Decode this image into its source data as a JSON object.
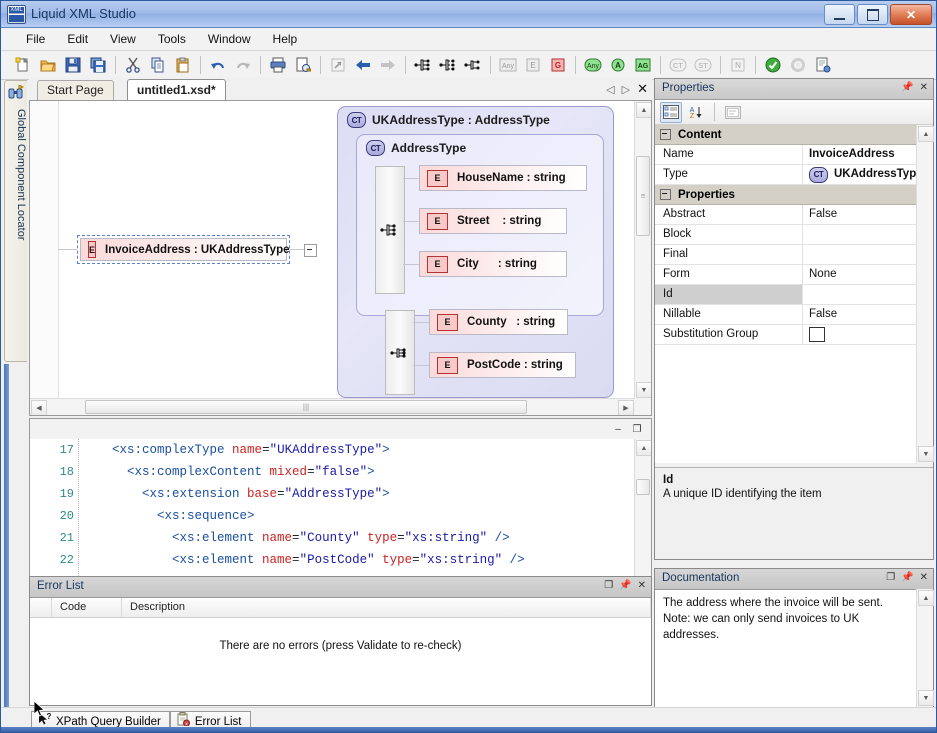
{
  "window": {
    "title": "Liquid XML Studio",
    "icon": "xml-app-icon",
    "buttons": {
      "minimize": "–",
      "maximize": "□",
      "close": "✕"
    }
  },
  "menu": {
    "items": [
      "File",
      "Edit",
      "View",
      "Tools",
      "Window",
      "Help"
    ]
  },
  "toolbar": {
    "groups": [
      {
        "buttons": [
          {
            "name": "new-file-icon",
            "glyph": "🗋"
          },
          {
            "name": "open-file-icon",
            "glyph": "📂"
          },
          {
            "name": "save-icon",
            "glyph": "💾"
          },
          {
            "name": "save-all-icon",
            "glyph": "🖫"
          }
        ]
      },
      {
        "buttons": [
          {
            "name": "cut-icon",
            "glyph": "✂"
          },
          {
            "name": "copy-icon",
            "glyph": "⧉"
          },
          {
            "name": "paste-icon",
            "glyph": "📋"
          }
        ]
      },
      {
        "buttons": [
          {
            "name": "undo-icon",
            "glyph": "↶"
          },
          {
            "name": "redo-icon",
            "glyph": "↷"
          }
        ]
      },
      {
        "buttons": [
          {
            "name": "print-icon",
            "glyph": "🖨"
          },
          {
            "name": "print-preview-icon",
            "glyph": "🔍"
          }
        ]
      },
      {
        "buttons": [
          {
            "name": "navigate-icon",
            "glyph": "↗"
          },
          {
            "name": "back-icon",
            "glyph": "⬅"
          },
          {
            "name": "forward-icon",
            "glyph": "➡"
          }
        ]
      },
      {
        "buttons": [
          {
            "name": "add-sequence-icon",
            "glyph": "seq"
          },
          {
            "name": "add-choice-icon",
            "glyph": "seq"
          },
          {
            "name": "add-all-icon",
            "glyph": "seq"
          }
        ]
      },
      {
        "buttons": [
          {
            "name": "any-icon",
            "glyph": "Any"
          },
          {
            "name": "element-icon",
            "glyph": "E"
          },
          {
            "name": "group-icon",
            "glyph": "G"
          }
        ]
      },
      {
        "buttons": [
          {
            "name": "any-attribute-icon",
            "glyph": "Any"
          },
          {
            "name": "attribute-icon",
            "glyph": "A"
          },
          {
            "name": "attribute-group-icon",
            "glyph": "AG"
          }
        ]
      },
      {
        "buttons": [
          {
            "name": "complex-type-icon",
            "glyph": "CT"
          },
          {
            "name": "simple-type-icon",
            "glyph": "ST"
          }
        ]
      },
      {
        "buttons": [
          {
            "name": "notation-icon",
            "glyph": "N"
          }
        ]
      },
      {
        "buttons": [
          {
            "name": "validate-icon",
            "glyph": "✔"
          },
          {
            "name": "settings-icon",
            "glyph": "⚙"
          },
          {
            "name": "generate-code-icon",
            "glyph": "📄"
          }
        ]
      }
    ]
  },
  "left_sidebar": {
    "tab_label": "Global Component Locator",
    "icon": "binoculars-icon"
  },
  "document_tabs": {
    "tabs": [
      {
        "label": "Start Page",
        "active": false
      },
      {
        "label": "untitled1.xsd*",
        "active": true
      }
    ],
    "nav": {
      "prev": "◁",
      "next": "▷",
      "close": "✕"
    }
  },
  "diagram": {
    "selected_node": {
      "badge": "E",
      "label": "InvoiceAddress : UKAddressType"
    },
    "outer_type": {
      "badge": "CT",
      "label": "UKAddressType : AddressType"
    },
    "inner_type": {
      "badge": "CT",
      "label": "AddressType"
    },
    "inner_elements": [
      {
        "badge": "E",
        "label": "HouseName : string"
      },
      {
        "badge": "E",
        "label": "Street    : string"
      },
      {
        "badge": "E",
        "label": "City      : string"
      }
    ],
    "outer_elements": [
      {
        "badge": "E",
        "label": "County   : string"
      },
      {
        "badge": "E",
        "label": "PostCode : string"
      }
    ]
  },
  "code_editor": {
    "header_buttons": {
      "minimize": "–",
      "maximize": "❐"
    },
    "lines": [
      {
        "number": "17",
        "indent": 2,
        "tokens": [
          {
            "t": "tg",
            "v": "<xs:complexType "
          },
          {
            "t": "at",
            "v": "name"
          },
          {
            "t": "pl",
            "v": "="
          },
          {
            "t": "vl",
            "v": "\"UKAddressType\""
          },
          {
            "t": "tg",
            "v": ">"
          }
        ]
      },
      {
        "number": "18",
        "indent": 3,
        "tokens": [
          {
            "t": "tg",
            "v": "<xs:complexContent "
          },
          {
            "t": "at",
            "v": "mixed"
          },
          {
            "t": "pl",
            "v": "="
          },
          {
            "t": "vl",
            "v": "\"false\""
          },
          {
            "t": "tg",
            "v": ">"
          }
        ]
      },
      {
        "number": "19",
        "indent": 4,
        "tokens": [
          {
            "t": "tg",
            "v": "<xs:extension "
          },
          {
            "t": "at",
            "v": "base"
          },
          {
            "t": "pl",
            "v": "="
          },
          {
            "t": "vl",
            "v": "\"AddressType\""
          },
          {
            "t": "tg",
            "v": ">"
          }
        ]
      },
      {
        "number": "20",
        "indent": 5,
        "tokens": [
          {
            "t": "tg",
            "v": "<xs:sequence>"
          }
        ]
      },
      {
        "number": "21",
        "indent": 6,
        "tokens": [
          {
            "t": "tg",
            "v": "<xs:element "
          },
          {
            "t": "at",
            "v": "name"
          },
          {
            "t": "pl",
            "v": "="
          },
          {
            "t": "vl",
            "v": "\"County\""
          },
          {
            "t": "pl",
            "v": " "
          },
          {
            "t": "at",
            "v": "type"
          },
          {
            "t": "pl",
            "v": "="
          },
          {
            "t": "vl",
            "v": "\"xs:string\""
          },
          {
            "t": "tg",
            "v": " />"
          }
        ]
      },
      {
        "number": "22",
        "indent": 6,
        "tokens": [
          {
            "t": "tg",
            "v": "<xs:element "
          },
          {
            "t": "at",
            "v": "name"
          },
          {
            "t": "pl",
            "v": "="
          },
          {
            "t": "vl",
            "v": "\"PostCode\""
          },
          {
            "t": "pl",
            "v": " "
          },
          {
            "t": "at",
            "v": "type"
          },
          {
            "t": "pl",
            "v": "="
          },
          {
            "t": "vl",
            "v": "\"xs:string\""
          },
          {
            "t": "tg",
            "v": " />"
          }
        ]
      }
    ]
  },
  "error_list": {
    "title": "Error List",
    "columns": [
      "",
      "Code",
      "Description"
    ],
    "message": "There are no errors (press Validate to re-check)",
    "header_buttons": {
      "float": "❐",
      "pin": "📌",
      "close": "✕"
    }
  },
  "properties": {
    "title": "Properties",
    "header_buttons": {
      "pin": "📌",
      "close": "✕"
    },
    "toolbar": [
      {
        "name": "categorized-view-button",
        "glyph": "▤",
        "active": true
      },
      {
        "name": "alphabetical-sort-button",
        "glyph": "A↓",
        "active": false
      },
      {
        "name": "property-pages-button",
        "glyph": "▭",
        "active": false
      }
    ],
    "sections": [
      {
        "name": "Content",
        "rows": [
          {
            "name": "Name",
            "value": "InvoiceAddress",
            "bold": true,
            "selected": false,
            "badge": ""
          },
          {
            "name": "Type",
            "value": "UKAddressType",
            "bold": true,
            "selected": false,
            "badge": "CT"
          }
        ]
      },
      {
        "name": "Properties",
        "rows": [
          {
            "name": "Abstract",
            "value": "False",
            "bold": false,
            "selected": false,
            "badge": ""
          },
          {
            "name": "Block",
            "value": "",
            "bold": false,
            "selected": false,
            "badge": ""
          },
          {
            "name": "Final",
            "value": "",
            "bold": false,
            "selected": false,
            "badge": ""
          },
          {
            "name": "Form",
            "value": "None",
            "bold": false,
            "selected": false,
            "badge": ""
          },
          {
            "name": "Id",
            "value": "",
            "bold": false,
            "selected": true,
            "badge": ""
          },
          {
            "name": "Nillable",
            "value": "False",
            "bold": false,
            "selected": false,
            "badge": ""
          },
          {
            "name": "Substitution Group",
            "value": "",
            "bold": false,
            "selected": false,
            "badge": "emptybox"
          }
        ]
      }
    ],
    "description": {
      "title": "Id",
      "text": "A unique ID identifying the item"
    }
  },
  "documentation": {
    "title": "Documentation",
    "text": "The address where the invoice will be sent. Note: we can only send invoices to UK addresses.",
    "header_buttons": {
      "float": "❐",
      "pin": "📌",
      "close": "✕"
    }
  },
  "status_bar": {
    "tabs": [
      {
        "label": "XPath Query Builder",
        "icon": "cursor-question-icon",
        "active": false
      },
      {
        "label": "Error List",
        "icon": "error-list-icon",
        "active": false
      }
    ]
  },
  "colors": {
    "accent": "#3b63a8",
    "title_gradient_start": "#b7cdf0",
    "element_fill": "#fbdada",
    "element_badge_border": "#b03434",
    "complex_type_fill": "#dcdcf4",
    "selection_dash": "#5d7fd0",
    "xml_tag": "#1a4fa0",
    "xml_attr": "#cc2222",
    "xml_value": "#1a1aa8",
    "line_number": "#2e8b8b"
  }
}
